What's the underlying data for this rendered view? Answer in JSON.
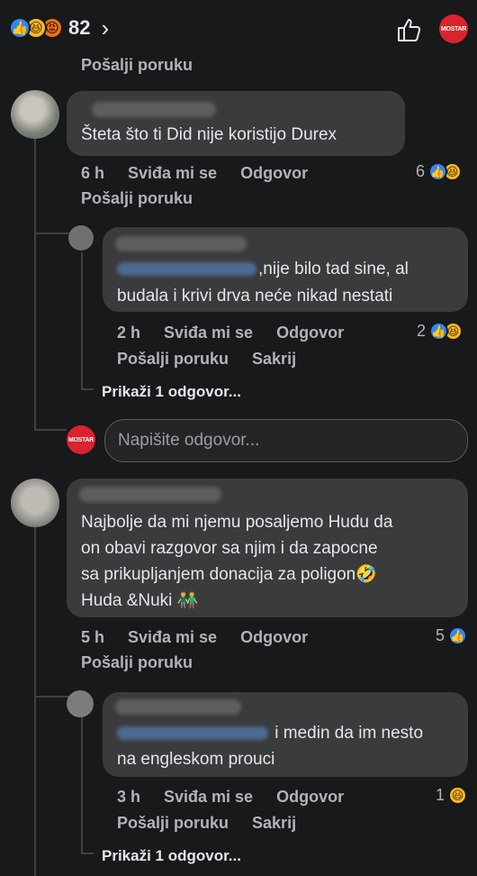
{
  "header": {
    "reaction_icons": [
      "like-icon",
      "haha-icon",
      "angry-icon"
    ],
    "reaction_count": "82",
    "brand_text": "MOSTAR"
  },
  "colors": {
    "background": "#18191a",
    "bubble": "#3a3b3c",
    "like_blue": "#2d88ff",
    "brand_red": "#d9232d"
  },
  "top_send_message": "Pošalji poruku",
  "comments": [
    {
      "text": "Šteta što ti Did nije koristijo Durex",
      "time": "6 h",
      "like": "Sviđa mi se",
      "reply": "Odgovor",
      "send_message": "Pošalji poruku",
      "reaction_count": "6",
      "replies": [
        {
          "text1": ",nije bilo tad sine, al",
          "text2": "budala i krivi drva neće nikad nestati",
          "time": "2 h",
          "like": "Sviđa mi se",
          "reply": "Odgovor",
          "send_message": "Pošalji poruku",
          "hide": "Sakrij",
          "reaction_count": "2"
        }
      ],
      "view_more": "Prikaži 1 odgovor...",
      "input_placeholder": "Napišite odgovor..."
    },
    {
      "lines": [
        "Najbolje da mi njemu posaljemo Hudu da",
        "on obavi razgovor sa njim i da zapocne",
        "sa prikupljanjem donacija za poligon🤣",
        "Huda &Nuki 👬"
      ],
      "time": "5 h",
      "like": "Sviđa mi se",
      "reply": "Odgovor",
      "send_message": "Pošalji poruku",
      "reaction_count": "5",
      "replies": [
        {
          "text1": " i medin da im nesto",
          "text2": "na engleskom prouci",
          "time": "3 h",
          "like": "Sviđa mi se",
          "reply": "Odgovor",
          "send_message": "Pošalji poruku",
          "hide": "Sakrij",
          "reaction_count": "1"
        }
      ],
      "view_more": "Prikaži 1 odgovor..."
    }
  ]
}
